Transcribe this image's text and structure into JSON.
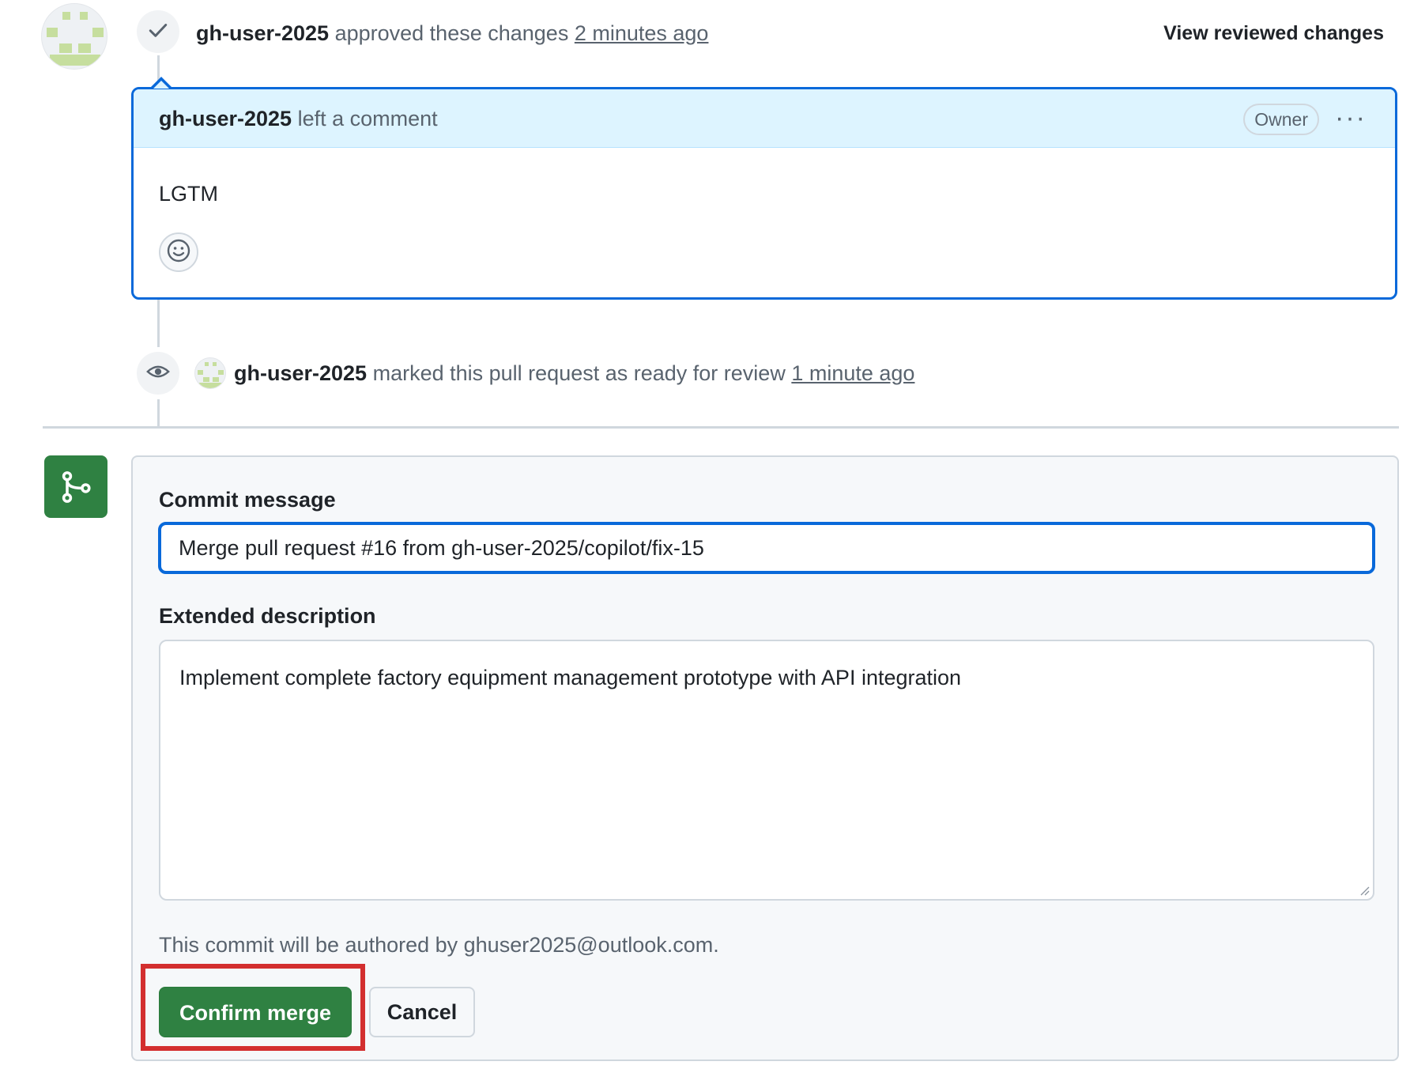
{
  "review": {
    "user": "gh-user-2025",
    "action": "approved these changes",
    "time": "2 minutes ago",
    "view_reviewed": "View reviewed changes",
    "icon": "check-icon"
  },
  "comment": {
    "user": "gh-user-2025",
    "action": "left a comment",
    "owner_badge": "Owner",
    "more": "···",
    "body": "LGTM"
  },
  "ready_event": {
    "user": "gh-user-2025",
    "action": "marked this pull request as ready for review",
    "time": "1 minute ago",
    "icon": "eye-icon"
  },
  "merge_form": {
    "commit_label": "Commit message",
    "commit_value": "Merge pull request #16 from gh-user-2025/copilot/fix-15",
    "desc_label": "Extended description",
    "desc_value": "Implement complete factory equipment management prototype with API integration",
    "author_note": "This commit will be authored by ghuser2025@outlook.com.",
    "confirm_label": "Confirm merge",
    "cancel_label": "Cancel"
  },
  "colors": {
    "accent_blue": "#0969da",
    "merge_green": "#2f8142",
    "highlight_red": "#d32f2f"
  }
}
